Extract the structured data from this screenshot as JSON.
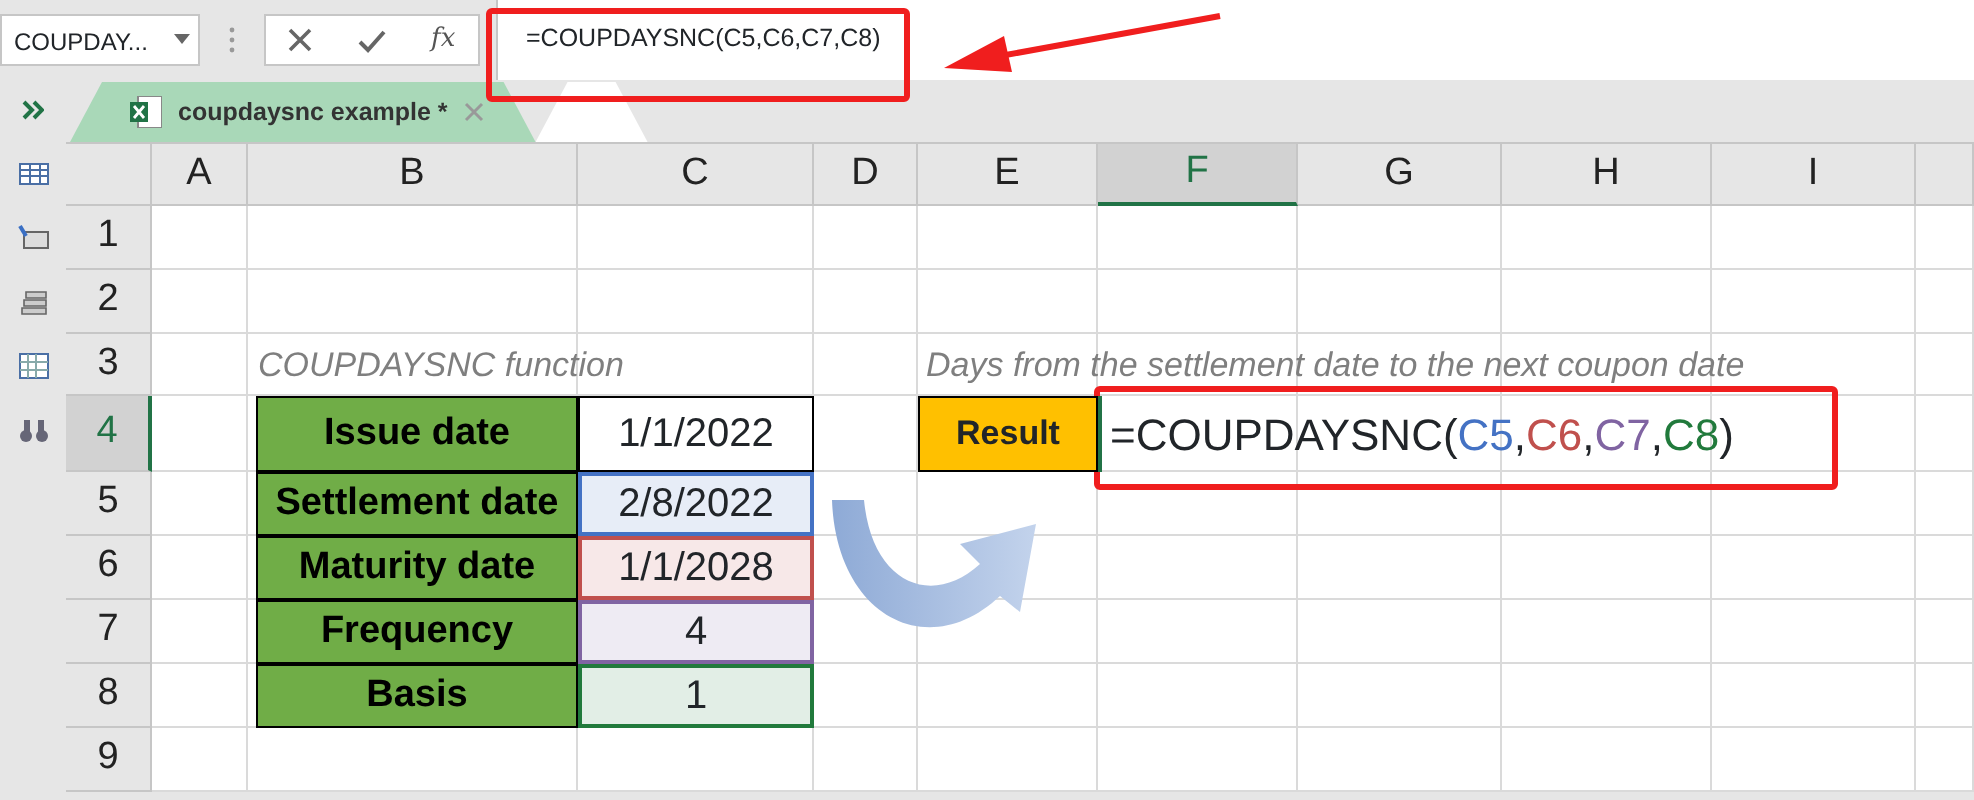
{
  "name_box": {
    "value": "COUPDAY..."
  },
  "formula_bar": {
    "function_label": "fx",
    "value": "=COUPDAYSNC(C5,C6,C7,C8)"
  },
  "sheet_tab": {
    "label": "coupdaysnc example *",
    "selected": true
  },
  "columns": [
    {
      "label": "A",
      "selected": false
    },
    {
      "label": "B",
      "selected": false
    },
    {
      "label": "C",
      "selected": false
    },
    {
      "label": "D",
      "selected": false
    },
    {
      "label": "E",
      "selected": false
    },
    {
      "label": "F",
      "selected": true
    },
    {
      "label": "G",
      "selected": false
    },
    {
      "label": "H",
      "selected": false
    },
    {
      "label": "I",
      "selected": false
    }
  ],
  "rows": [
    {
      "label": "1",
      "selected": false
    },
    {
      "label": "2",
      "selected": false
    },
    {
      "label": "3",
      "selected": false
    },
    {
      "label": "4",
      "selected": true
    },
    {
      "label": "5",
      "selected": false
    },
    {
      "label": "6",
      "selected": false
    },
    {
      "label": "7",
      "selected": false
    },
    {
      "label": "8",
      "selected": false
    },
    {
      "label": "9",
      "selected": false
    }
  ],
  "caption": "COUPDAYSNC function",
  "table": [
    {
      "label": "Issue date",
      "value": "1/1/2022"
    },
    {
      "label": "Settlement date",
      "value": "2/8/2022",
      "color": "#4472c4"
    },
    {
      "label": "Maturity date",
      "value": "1/1/2028",
      "color": "#c0504d"
    },
    {
      "label": "Frequency",
      "value": "4",
      "color": "#8064a2"
    },
    {
      "label": "Basis",
      "value": "1",
      "color": "#217a3c"
    }
  ],
  "note": "Days from the settlement date to the next coupon date",
  "result": {
    "label": "Result",
    "formula": [
      {
        "text": "=COUPDAYSNC("
      },
      {
        "text": "C5",
        "color": "#4472c4"
      },
      {
        "text": ","
      },
      {
        "text": "C6",
        "color": "#c0504d"
      },
      {
        "text": ","
      },
      {
        "text": "C7",
        "color": "#8064a2"
      },
      {
        "text": ","
      },
      {
        "text": "C8",
        "color": "#217a3c"
      },
      {
        "text": ")"
      }
    ]
  }
}
